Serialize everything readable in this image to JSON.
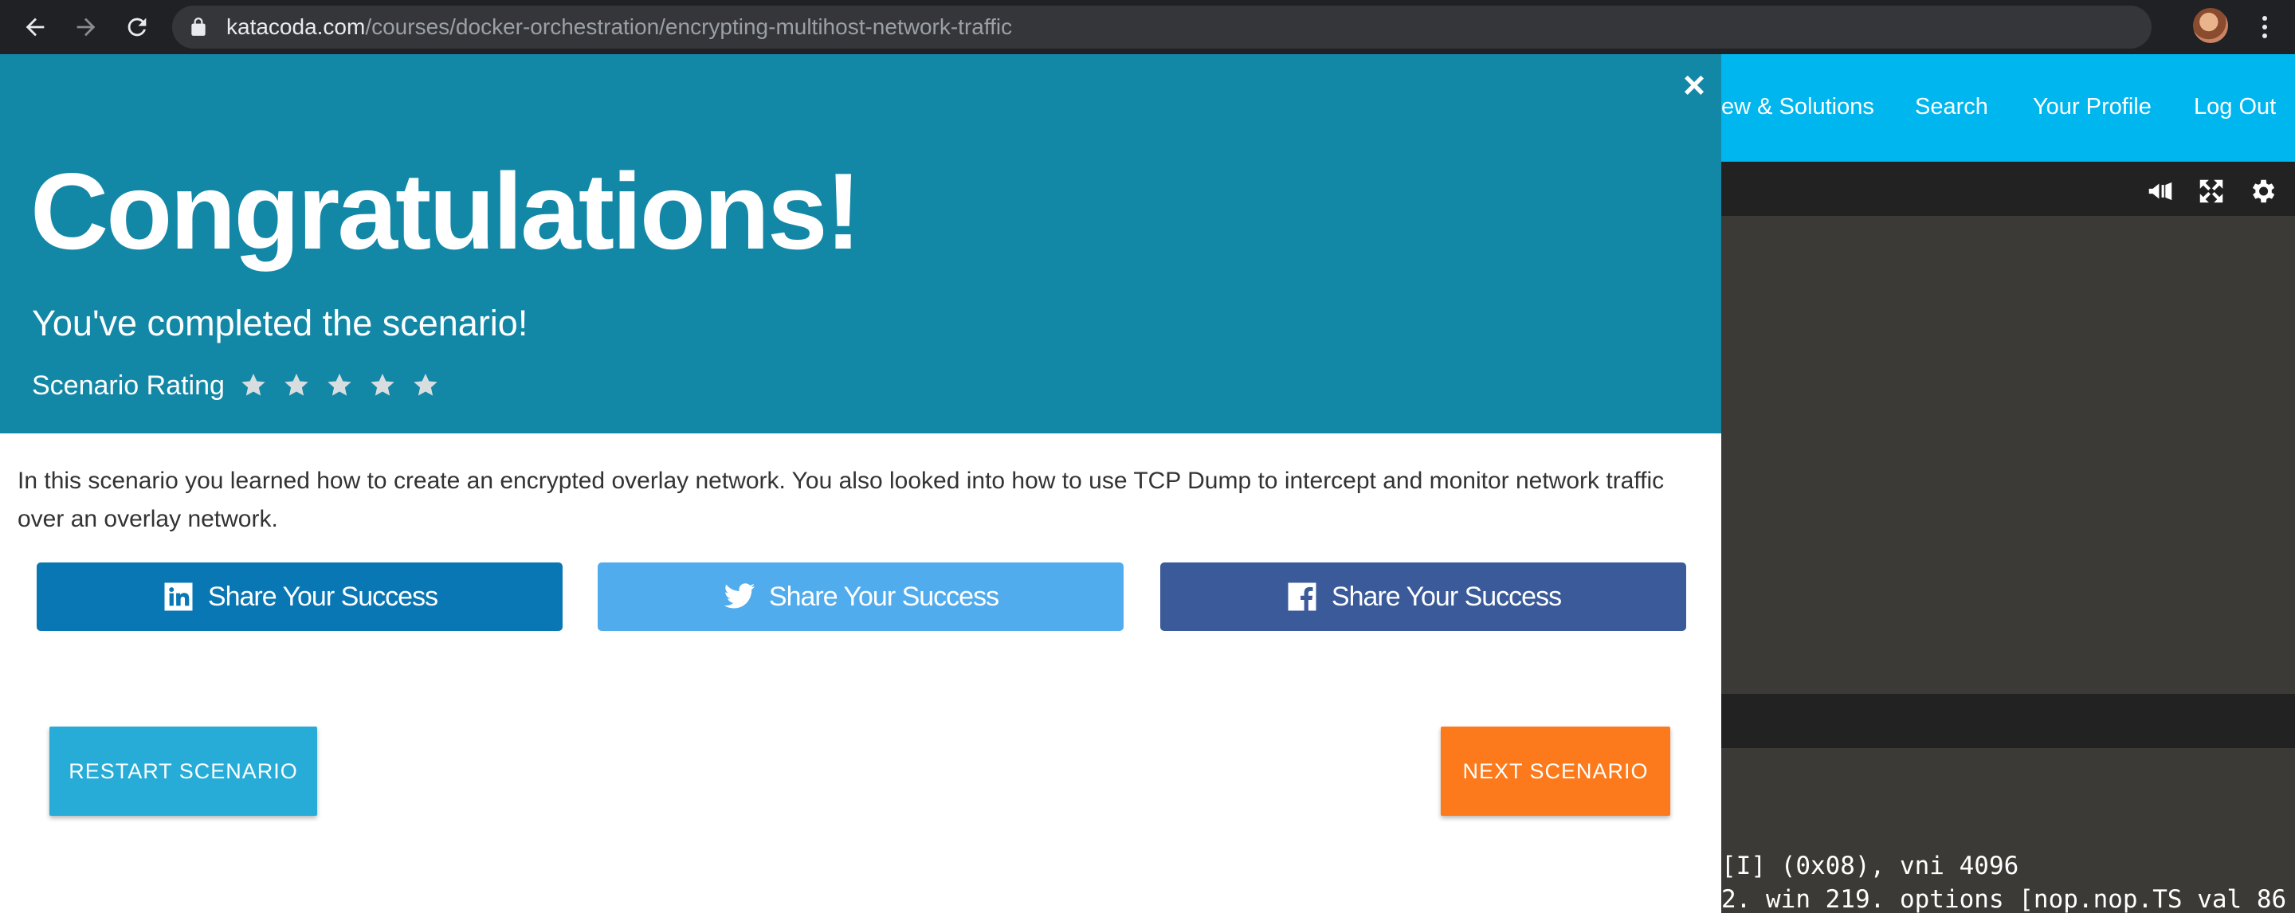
{
  "browser": {
    "url_host": "katacoda.com",
    "url_path": "/courses/docker-orchestration/encrypting-multihost-network-traffic"
  },
  "site": {
    "nav": [
      "ew & Solutions",
      "Search",
      "Your Profile",
      "Log Out"
    ]
  },
  "terminal": {
    "lines": [
      "[I] (0x08), vni 4096",
      "2. win 219. options [nop.nop.TS val 86"
    ]
  },
  "modal": {
    "close": "×",
    "title": "Congratulations!",
    "subtitle": "You've completed the scenario!",
    "rating_label": "Scenario Rating",
    "rating_stars": 5,
    "summary": "In this scenario you learned how to create an encrypted overlay network. You also looked into how to use TCP Dump to intercept and monitor network traffic over an overlay network.",
    "share": {
      "linkedin": "Share Your Success",
      "twitter": "Share Your Success",
      "facebook": "Share Your Success"
    },
    "restart": "RESTART SCENARIO",
    "next": "NEXT SCENARIO"
  },
  "colors": {
    "hero": "#1387a6",
    "header": "#00b6ef",
    "linkedin": "#0a77b5",
    "twitter": "#51acee",
    "facebook": "#3a5a99",
    "restart": "#27acd8",
    "next": "#fc7a1b"
  }
}
